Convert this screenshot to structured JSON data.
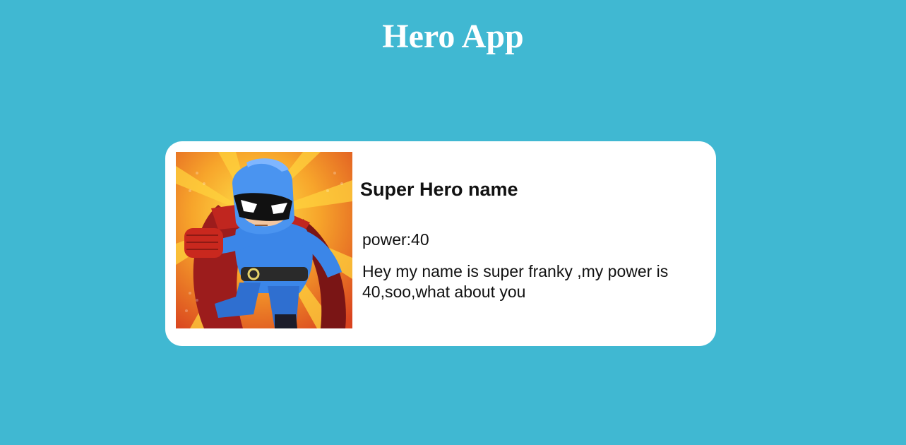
{
  "header": {
    "title": "Hero App"
  },
  "card": {
    "image_icon": "superhero-illustration",
    "name": "Super Hero name",
    "power": "power:40",
    "description": "Hey my name is super franky ,my power is 40,soo,what about you"
  }
}
